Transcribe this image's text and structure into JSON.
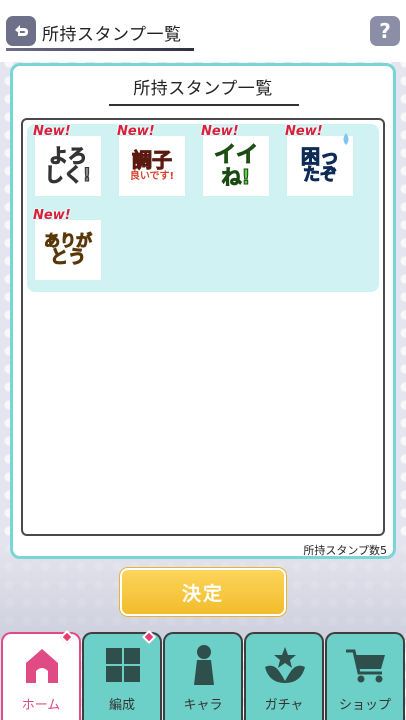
{
  "header": {
    "title": "所持スタンプ一覧",
    "help_label": "?"
  },
  "panel": {
    "title": "所持スタンプ一覧",
    "stamp_count_label": "所持スタンプ数5"
  },
  "stamps": [
    {
      "new_label": "New!",
      "text_line1": "よろ",
      "text_line2": "しく!",
      "color": "#7a7a7a"
    },
    {
      "new_label": "New!",
      "text_line1": "調子",
      "text_line2": "良いです!",
      "color": "#d6432a"
    },
    {
      "new_label": "New!",
      "text_line1": "イイ",
      "text_line2": "ね!",
      "color": "#4fc13a"
    },
    {
      "new_label": "New!",
      "text_line1": "困っ",
      "text_line2": "たぞ",
      "color": "#3c7fd6"
    },
    {
      "new_label": "New!",
      "text_line1": "ありが",
      "text_line2": "とう",
      "color": "#e89a24"
    }
  ],
  "decide_label": "決定",
  "nav": [
    {
      "label": "ホーム",
      "icon": "home-icon",
      "active": true,
      "badge": true
    },
    {
      "label": "編成",
      "icon": "formation-grid-icon",
      "active": false,
      "badge": true
    },
    {
      "label": "キャラ",
      "icon": "character-icon",
      "active": false,
      "badge": false
    },
    {
      "label": "ガチャ",
      "icon": "gacha-icon",
      "active": false,
      "badge": false
    },
    {
      "label": "ショップ",
      "icon": "shop-cart-icon",
      "active": false,
      "badge": false
    }
  ],
  "colors": {
    "accent_teal": "#78d6d6",
    "nav_teal": "#6cd0c8",
    "home_pink": "#e04b86",
    "decide_yellow": "#f2bc2c",
    "new_red": "#d8203a"
  }
}
